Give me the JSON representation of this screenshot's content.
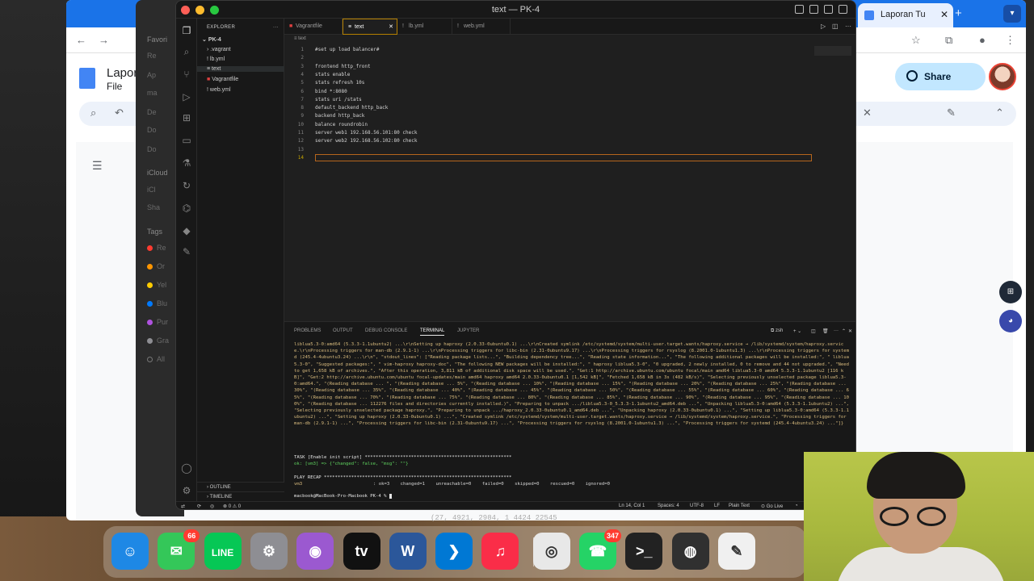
{
  "browser": {
    "tab_title": "Laporan Tu",
    "doc_title": "Lapor",
    "menu_file": "File",
    "share_label": "Share"
  },
  "finder": {
    "favorites_label": "Favori",
    "icloud_label": "iCloud",
    "tags_label": "Tags",
    "items": [
      "Re",
      "Ap",
      "ma",
      "De",
      "Do",
      "Do",
      "iCl",
      "Sha",
      "Re",
      "Or",
      "Yel",
      "Blu",
      "Pur",
      "Gra",
      "All"
    ],
    "tag_colors": [
      "#ff3b30",
      "#ff9500",
      "#ffcc00",
      "#007aff",
      "#af52de",
      "#8e8e93"
    ]
  },
  "vscode": {
    "window_title": "text — PK-4",
    "explorer_header": "EXPLORER",
    "project": "PK-4",
    "tree": [
      ".vagrant",
      "lb.yml",
      "text",
      "Vagrantfile",
      "web.yml"
    ],
    "tabs": [
      {
        "label": "Vagrantfile"
      },
      {
        "label": "text",
        "active": true
      },
      {
        "label": "lb.yml"
      },
      {
        "label": "web.yml"
      }
    ],
    "breadcrumb": "text",
    "code_lines": [
      "#set up load balancer#",
      "",
      "frontend http_front",
      "stats enable",
      "stats refresh 10s",
      "bind *:8080",
      "stats uri /stats",
      "default_backend http_back",
      "backend http_back",
      "balance roundrobin",
      "server web1 192.168.56.101:80 check",
      "server web2 192.168.56.102:80 check",
      "",
      ""
    ],
    "panel_tabs": [
      "PROBLEMS",
      "OUTPUT",
      "DEBUG CONSOLE",
      "TERMINAL",
      "JUPYTER"
    ],
    "panel_active": "TERMINAL",
    "shell_label": "zsh",
    "terminal_output": "liblua5.3-0:amd64 (5.3.3-1.1ubuntu2) ...\\r\\nSetting up haproxy (2.0.33-0ubuntu0.1) ...\\r\\nCreated symlink /etc/systemd/system/multi-user.target.wants/haproxy.service → /lib/systemd/system/haproxy.service.\\r\\nProcessing triggers for man-db (2.9.1-1) ...\\r\\nProcessing triggers for libc-bin (2.31-0ubuntu9.17) ...\\r\\nProcessing triggers for rsyslog (8.2001.0-1ubuntu1.3) ...\\r\\nProcessing triggers for systemd (245.4-4ubuntu3.24) ...\\r\\n\", \"stdout_lines\": [\"Reading package lists...\", \"Building dependency tree...\", \"Reading state information...\", \"The following additional packages will be installed:\", \"  liblua5.3-0\", \"Suggested packages:\", \"  vim-haproxy haproxy-doc\", \"The following NEW packages will be installed:\", \"  haproxy liblua5.3-0\", \"0 upgraded, 2 newly installed, 0 to remove and 44 not upgraded.\", \"Need to get 1,658 kB of archives.\", \"After this operation, 3,811 kB of additional disk space will be used.\", \"Get:1 http://archive.ubuntu.com/ubuntu focal/main amd64 liblua5.3-0 amd64 5.3.3-1.1ubuntu2 [116 kB]\", \"Get:2 http://archive.ubuntu.com/ubuntu focal-updates/main amd64 haproxy amd64 2.0.33-0ubuntu0.1 [1,542 kB]\", \"Fetched 1,658 kB in 3s (482 kB/s)\", \"Selecting previously unselected package liblua5.3-0:amd64.\", \"(Reading database ... \", \"(Reading database ... 5%\", \"(Reading database ... 10%\", \"(Reading database ... 15%\", \"(Reading database ... 20%\", \"(Reading database ... 25%\", \"(Reading database ... 30%\", \"(Reading database ... 35%\", \"(Reading database ... 40%\", \"(Reading database ... 45%\", \"(Reading database ... 50%\", \"(Reading database ... 55%\", \"(Reading database ... 60%\", \"(Reading database ... 65%\", \"(Reading database ... 70%\", \"(Reading database ... 75%\", \"(Reading database ... 80%\", \"(Reading database ... 85%\", \"(Reading database ... 90%\", \"(Reading database ... 95%\", \"(Reading database ... 100%\", \"(Reading database ... 112276 files and directories currently installed.)\", \"Preparing to unpack .../liblua5.3-0_5.3.3-1.1ubuntu2_amd64.deb ...\", \"Unpacking liblua5.3-0:amd64 (5.3.3-1.1ubuntu2) ...\", \"Selecting previously unselected package haproxy.\", \"Preparing to unpack .../haproxy_2.0.33-0ubuntu0.1_amd64.deb ...\", \"Unpacking haproxy (2.0.33-0ubuntu0.1) ...\", \"Setting up liblua5.3-0:amd64 (5.3.3-1.1ubuntu2) ...\", \"Setting up haproxy (2.0.33-0ubuntu0.1) ...\", \"Created symlink /etc/systemd/system/multi-user.target.wants/haproxy.service → /lib/systemd/system/haproxy.service.\", \"Processing triggers for man-db (2.9.1-1) ...\", \"Processing triggers for libc-bin (2.31-0ubuntu9.17) ...\", \"Processing triggers for rsyslog (8.2001.0-1ubuntu1.3) ...\", \"Processing triggers for systemd (245.4-4ubuntu3.24) ...\"]}",
    "task_line": "TASK [Enable init script] ******************************************************",
    "ok_line": "ok: [vm3] => {\"changed\": false, \"msg\": \"\"}",
    "recap_line": "PLAY RECAP *********************************************************************",
    "recap_host": "vm3",
    "recap_stats": ": ok=3    changed=1    unreachable=0    failed=0    skipped=0    rescued=0    ignored=0",
    "prompt": "macbook@MacBook-Pro-Macbook PK-4 % ",
    "outline_label": "OUTLINE",
    "timeline_label": "TIMELINE",
    "status_problems": "⊗ 0 ⚠ 0",
    "status_ln": "Ln 14, Col 1",
    "status_spaces": "Spaces: 4",
    "status_enc": "UTF-8",
    "status_eol": "LF",
    "status_lang": "Plain Text",
    "status_golive": "Go Live"
  },
  "dock": {
    "apps": [
      {
        "name": "Finder",
        "glyph": "☺",
        "color": "#1e88e5"
      },
      {
        "name": "Messages",
        "glyph": "✉",
        "color": "#34c759",
        "badge": "66"
      },
      {
        "name": "LINE",
        "glyph": "LINE",
        "color": "#06c755"
      },
      {
        "name": "System Settings",
        "glyph": "⚙",
        "color": "#8e8e93"
      },
      {
        "name": "Podcasts",
        "glyph": "◉",
        "color": "#9b59d0"
      },
      {
        "name": "Apple TV",
        "glyph": "tv",
        "color": "#111111"
      },
      {
        "name": "Word",
        "glyph": "W",
        "color": "#2b579a"
      },
      {
        "name": "VS Code",
        "glyph": "❯",
        "color": "#0078d4"
      },
      {
        "name": "Music",
        "glyph": "♫",
        "color": "#fa2d48"
      },
      {
        "name": "Chrome",
        "glyph": "◎",
        "color": "#e8e8e8"
      },
      {
        "name": "WhatsApp",
        "glyph": "☎",
        "color": "#25d366",
        "badge": "347"
      },
      {
        "name": "Terminal",
        "glyph": ">_",
        "color": "#222222"
      },
      {
        "name": "OBS",
        "glyph": "◍",
        "color": "#303030"
      },
      {
        "name": "TextEdit",
        "glyph": "✎",
        "color": "#f0f0f0"
      }
    ],
    "coords_text": "(27, 4921, 2984, 1   4424   22545"
  }
}
